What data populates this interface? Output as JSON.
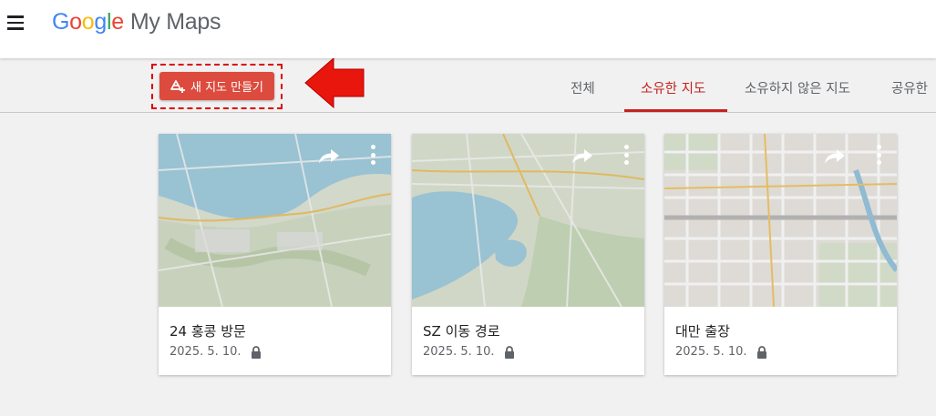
{
  "header": {
    "logo": [
      "G",
      "o",
      "o",
      "g",
      "l",
      "e"
    ],
    "product": "My Maps"
  },
  "toolbar": {
    "create_label": "새 지도 만들기"
  },
  "tabs": [
    {
      "label": "전체",
      "active": false
    },
    {
      "label": "소유한 지도",
      "active": true
    },
    {
      "label": "소유하지 않은 지도",
      "active": false
    },
    {
      "label": "공유한",
      "active": false
    }
  ],
  "maps": [
    {
      "title": "24 홍콩 방문",
      "date": "2025. 5. 10."
    },
    {
      "title": "SZ 이동 경로",
      "date": "2025. 5. 10."
    },
    {
      "title": "대만 출장",
      "date": "2025. 5. 10."
    }
  ],
  "colors": {
    "accent": "#c5221f",
    "create_button": "#dc4b3e",
    "water": "#a8d4e6",
    "land": "#e6ecdf"
  }
}
